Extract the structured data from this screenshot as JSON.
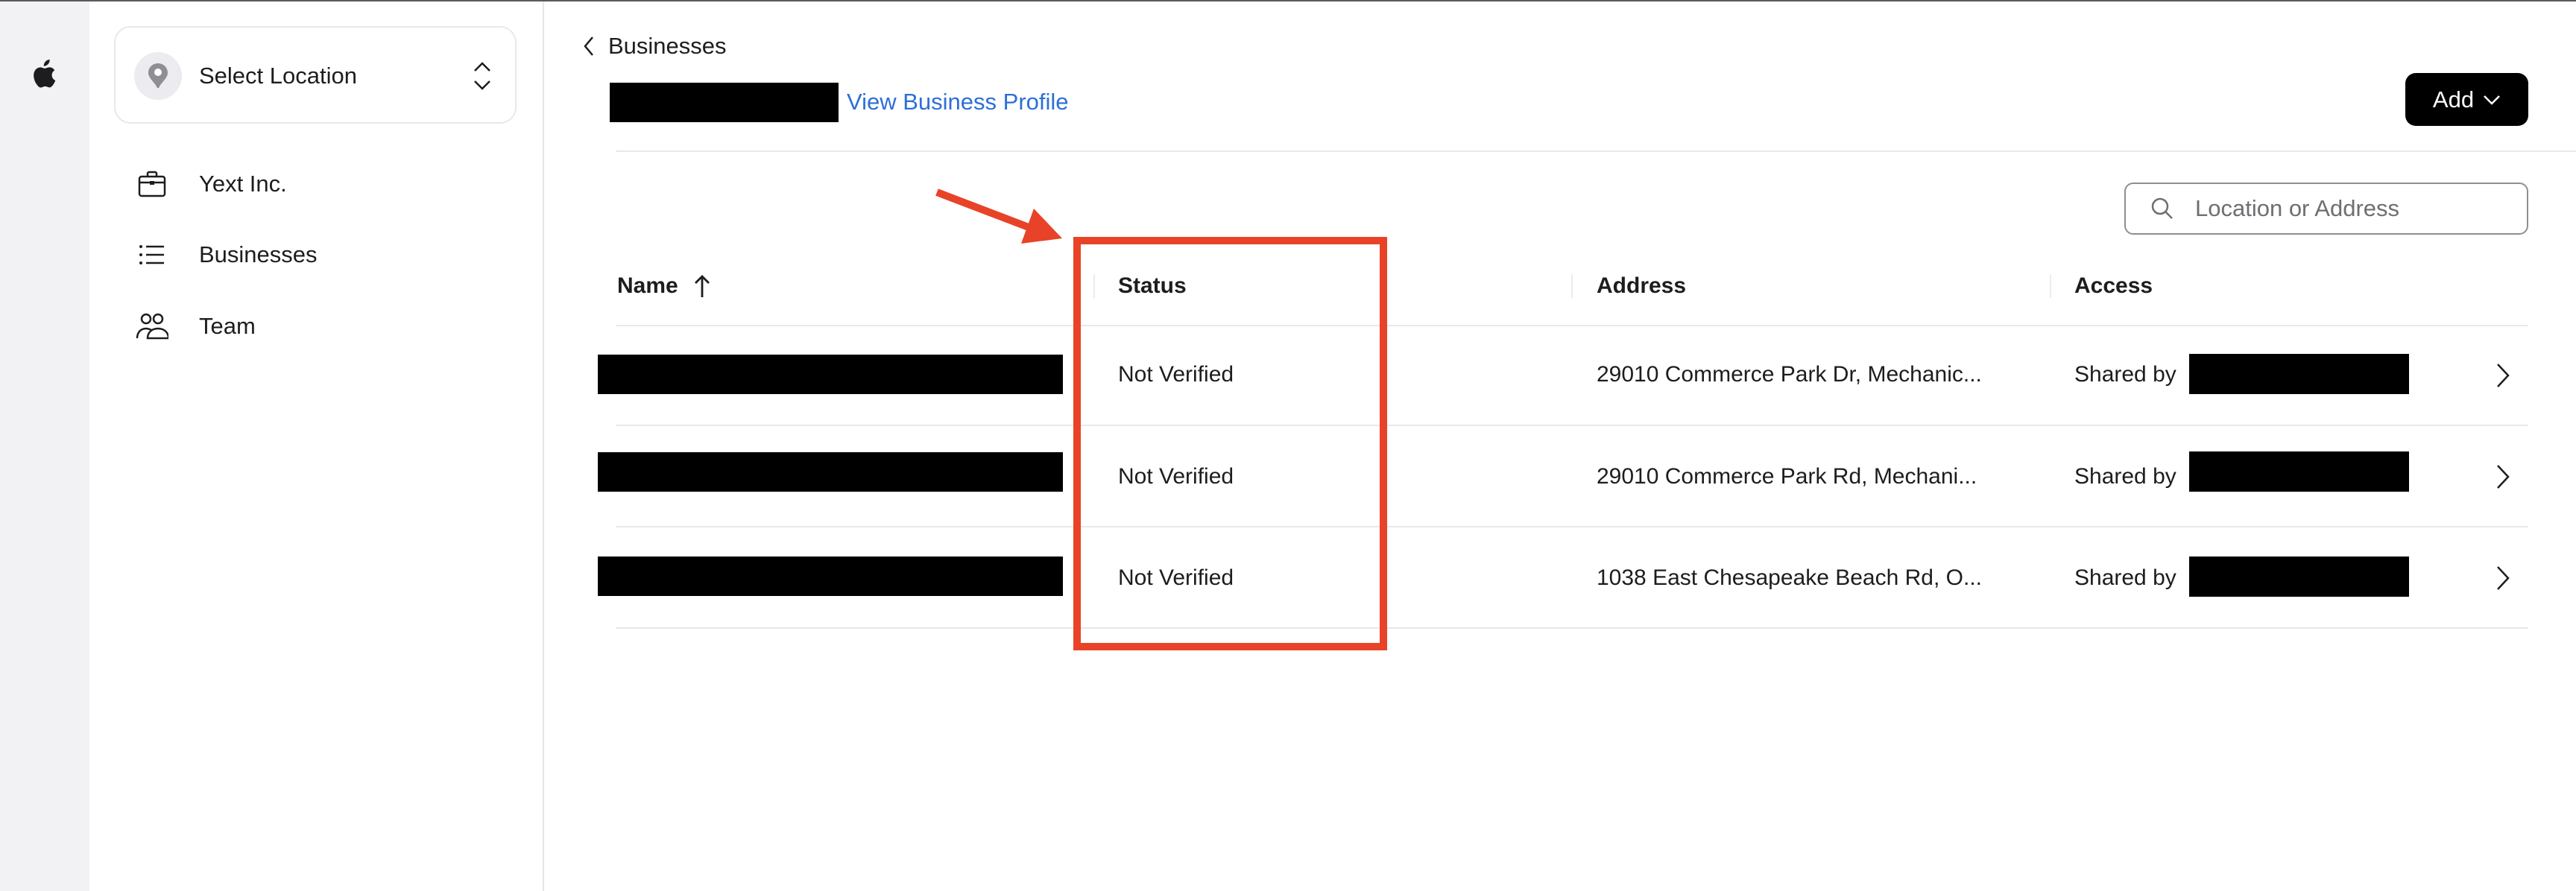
{
  "sidebar": {
    "location_selector": {
      "label": "Select Location",
      "icon": "map-pin-icon",
      "toggle_icon": "chevron-up-down-icon"
    },
    "items": [
      {
        "label": "Yext Inc.",
        "icon": "briefcase-icon"
      },
      {
        "label": "Businesses",
        "icon": "list-icon"
      },
      {
        "label": "Team",
        "icon": "people-icon"
      }
    ]
  },
  "header": {
    "breadcrumb": {
      "label": "Businesses",
      "icon": "chevron-left-icon"
    },
    "business_name": "[redacted]",
    "view_profile_link": "View Business Profile",
    "add_button": {
      "label": "Add",
      "icon": "chevron-down-icon"
    }
  },
  "search": {
    "placeholder": "Location or Address",
    "value": ""
  },
  "table": {
    "columns": [
      {
        "label": "Name",
        "sort": "ascending"
      },
      {
        "label": "Status"
      },
      {
        "label": "Address"
      },
      {
        "label": "Access"
      }
    ],
    "rows": [
      {
        "name": "[redacted]",
        "status": "Not Verified",
        "address": "29010 Commerce Park Dr, Mechanic...",
        "access_prefix": "Shared by",
        "access_owner": "[redacted]"
      },
      {
        "name": "[redacted]",
        "status": "Not Verified",
        "address": "29010 Commerce Park Rd, Mechani...",
        "access_prefix": "Shared by",
        "access_owner": "[redacted]"
      },
      {
        "name": "[redacted]",
        "status": "Not Verified",
        "address": "1038 East Chesapeake Beach Rd, O...",
        "access_prefix": "Shared by",
        "access_owner": "[redacted]"
      }
    ]
  },
  "annotation": {
    "target": "Status column",
    "color": "#e84328"
  },
  "colors": {
    "link": "#2d6fd6",
    "rail": "#f2f2f5",
    "primary_button": "#000000"
  }
}
